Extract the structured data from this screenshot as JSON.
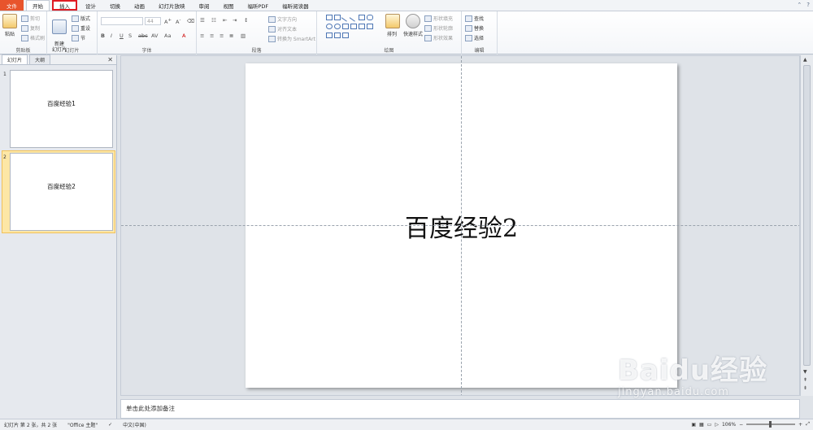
{
  "tabs": {
    "file": "文件",
    "home": "开始",
    "insert": "插入",
    "design": "设计",
    "transitions": "切换",
    "animations": "动画",
    "slideshow": "幻灯片放映",
    "review": "审阅",
    "view": "视图",
    "foxit_pdf": "福昕PDF",
    "foxit_reader": "福昕阅读器"
  },
  "ribbon": {
    "clipboard": {
      "label": "剪贴板",
      "paste": "粘贴",
      "cut": "剪切",
      "copy": "复制",
      "format_painter": "格式刷"
    },
    "slides": {
      "label": "幻灯片",
      "new_slide": "新建\n幻灯片",
      "layout": "版式",
      "reset": "重设",
      "section": "节"
    },
    "font": {
      "label": "字体",
      "size": "44"
    },
    "paragraph": {
      "label": "段落",
      "text_direction": "文字方向",
      "align_text": "对齐文本",
      "to_smartart": "转换为 SmartArt"
    },
    "drawing": {
      "label": "绘图",
      "arrange": "排列",
      "quick_styles": "快速样式",
      "shape_fill": "形状填充",
      "shape_outline": "形状轮廓",
      "shape_effects": "形状效果"
    },
    "editing": {
      "label": "编辑",
      "find": "查找",
      "replace": "替换",
      "select": "选择"
    }
  },
  "leftpanel": {
    "tab_slides": "幻灯片",
    "tab_outline": "大纲",
    "thumbnails": [
      {
        "num": "1",
        "text": "百度经验1"
      },
      {
        "num": "2",
        "text": "百度经验2"
      }
    ]
  },
  "slide": {
    "title": "百度经验2"
  },
  "notes": {
    "placeholder": "单击此处添加备注"
  },
  "statusbar": {
    "slide_info": "幻灯片 第 2 张，共 2 张",
    "theme": "\"Office 主题\"",
    "language": "中文(中国)",
    "zoom": "106%"
  },
  "watermark": {
    "logo": "Baidu经验",
    "url": "jingyan.baidu.com"
  }
}
